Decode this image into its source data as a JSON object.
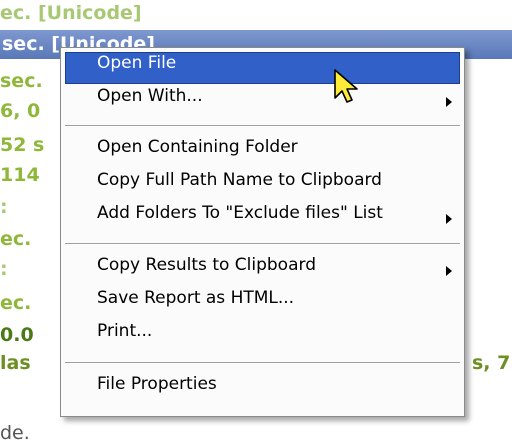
{
  "background": {
    "lines": [
      "ec. [Unicode]",
      "sec. [Unicode]",
      "sec.",
      "6, 0",
      "52 s",
      "114",
      ":",
      "ec.",
      ":",
      "ec.",
      "0.0",
      "las",
      "s, 7",
      "de."
    ]
  },
  "context_menu": {
    "items": {
      "open_file": "Open File",
      "open_with": "Open With...",
      "open_containing_folder": "Open Containing Folder",
      "copy_full_path": "Copy Full Path Name to Clipboard",
      "add_folders_exclude": "Add Folders To \"Exclude files\" List",
      "copy_results": "Copy Results to Clipboard",
      "save_report_html": "Save Report as HTML...",
      "print": "Print...",
      "file_properties": "File Properties"
    },
    "highlighted_item": "Open File",
    "icons": {
      "submenu": "submenu-arrow-icon",
      "pointer": "cursor-arrow-icon"
    }
  },
  "colors": {
    "highlight": "#3060c8",
    "selected_row": "#6a86c2",
    "green_text": "#8fb83a"
  }
}
